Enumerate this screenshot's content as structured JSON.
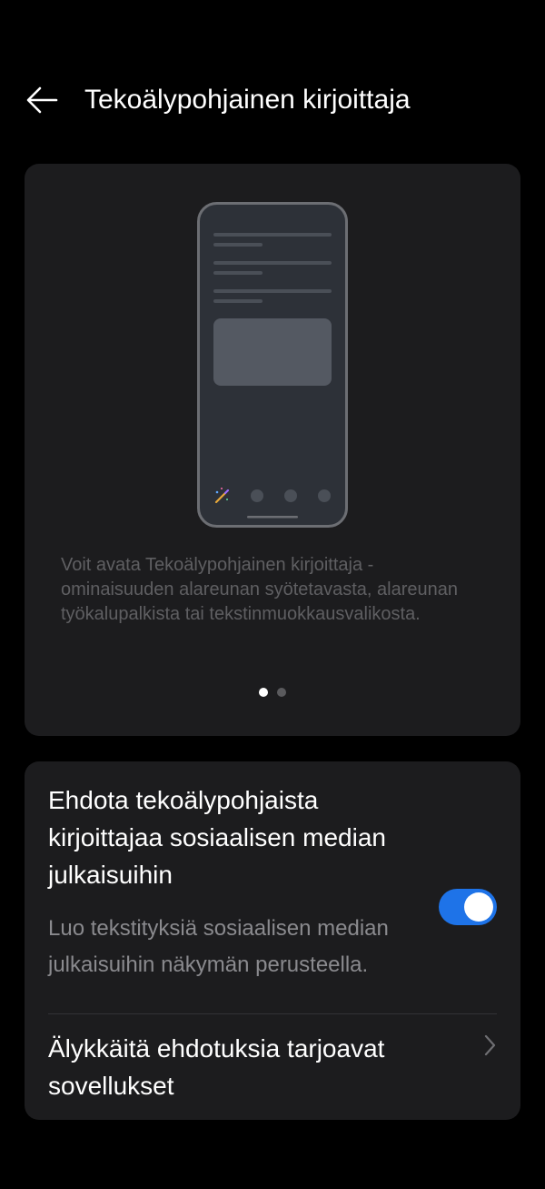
{
  "header": {
    "title": "Tekoälypohjainen kirjoittaja"
  },
  "intro": {
    "description": "Voit avata Tekoälypohjainen kirjoittaja -ominaisuuden alareunan syötetavasta, alareunan työkalupalkista tai tekstinmuokkausvalikosta.",
    "page_count": 2,
    "current_page": 1
  },
  "settings": {
    "suggest": {
      "title": "Ehdota tekoälypohjaista kirjoittajaa sosiaalisen median julkaisuihin",
      "description": "Luo tekstityksiä sosiaalisen median julkaisuihin näkymän perusteella.",
      "enabled": true
    },
    "apps": {
      "title": "Älykkäitä ehdotuksia tarjoavat sovellukset"
    }
  },
  "colors": {
    "background": "#000000",
    "card": "#1c1c1e",
    "toggle_on": "#1e73e8",
    "secondary_text": "#8a8a8e"
  },
  "icons": {
    "back": "back-arrow-icon",
    "chevron": "chevron-right-icon",
    "ai_pen": "ai-pen-icon"
  }
}
